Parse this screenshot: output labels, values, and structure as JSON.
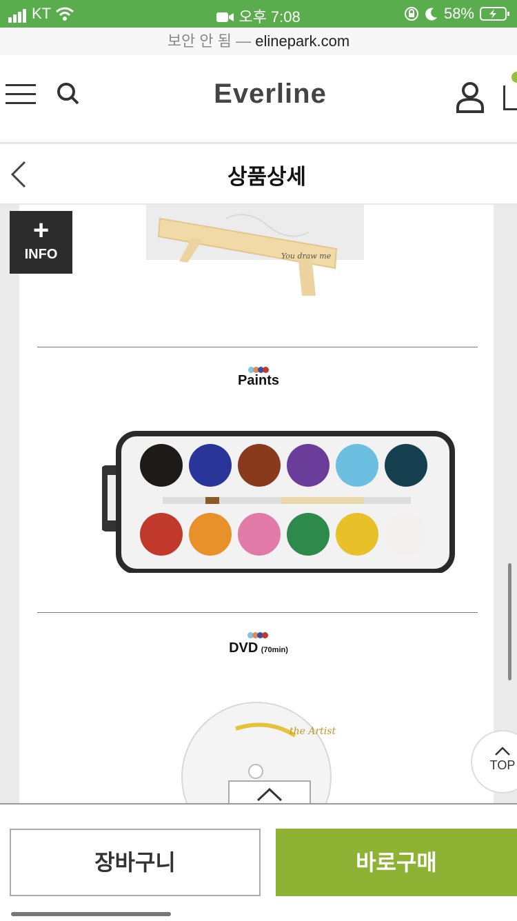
{
  "status": {
    "carrier": "KT",
    "time": "오후 7:08",
    "battery": "58%",
    "bar_color": "#5aad4c"
  },
  "browser": {
    "insecure_label": "보안 안 됨",
    "separator": " — ",
    "domain": "elinepark.com"
  },
  "header": {
    "logo": "Everline",
    "icons": [
      "menu-icon",
      "search-icon",
      "user-icon",
      "cart-icon"
    ]
  },
  "subheader": {
    "title": "상품상세"
  },
  "content": {
    "info_button": {
      "plus": "+",
      "label": "INFO"
    },
    "sections": [
      {
        "title": "Paints",
        "dot_colors": [
          "#7ec4e8",
          "#e08a57",
          "#3a4fa0",
          "#c0392b"
        ]
      },
      {
        "title": "DVD",
        "subtitle": "(70min)",
        "dot_colors": [
          "#7ec4e8",
          "#e08a57",
          "#3a4fa0",
          "#c0392b"
        ]
      }
    ],
    "paint_colors": [
      "#1e1a1a",
      "#2a3599",
      "#8a3a1c",
      "#6a3d9a",
      "#6cbfe0",
      "#163f4f",
      "#c0392b",
      "#e8902a",
      "#e27aa8",
      "#2e8a4a",
      "#e8c02a",
      "#f3f0ed"
    ],
    "top_button": "TOP"
  },
  "bottom_bar": {
    "cart_label": "장바구니",
    "buy_label": "바로구매",
    "accent": "#8db234"
  }
}
